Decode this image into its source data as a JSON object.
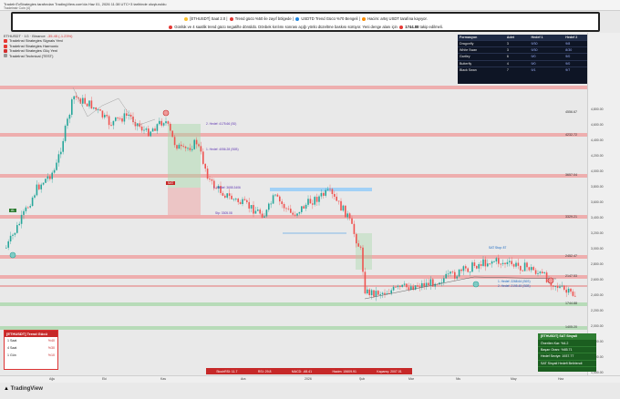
{
  "window": {
    "credit": "TradeInToStrategies tarafından TradingView.com'da Haz 01, 2026 11:38 UTC+3 tarihinde oluşturuldu",
    "symbol_label": "Tradeinstr Coin (4)"
  },
  "banner": {
    "line1_parts": [
      "[ETHUSDT] Saat 2.0",
      "Trend gücü %50 ile zayıf bölgede",
      "USDTD Trend Gücü %70 Bengeli",
      "Hacim: artış USDT tarafına kayıyor."
    ],
    "line2_parts": [
      "Günlük ve 4 saatlik trend gücü negatifte dönüldü. Dönbek kırılımı sonrası açığı yönlü düzeltme baskısı sürüyor. Yeni denge alanı için",
      "1744.88",
      "takip edilmeli."
    ]
  },
  "header": {
    "title": "ETHUSDT · 1G · Binance",
    "change": "-35.45 (-1.23%)",
    "indicators": [
      {
        "name": "TradeInst Strategies Signals Yeni",
        "color": "#e53935"
      },
      {
        "name": "TradeInst Strategies Harmonic",
        "color": "#e53935"
      },
      {
        "name": "TradeInst Strategies Güç Yeni",
        "color": "#d32f2f"
      },
      {
        "name": "TradeInst Technical (TEST)",
        "color": "#999999"
      }
    ]
  },
  "pattern_table": {
    "headers": [
      "Formasyon",
      "Adet",
      "Hedef 1",
      "Hedef 2"
    ],
    "rows": [
      [
        "Dragonfly",
        "3",
        "9/30",
        "9/8"
      ],
      [
        "White Swan",
        "3",
        "9/30",
        "8/30"
      ],
      [
        "Gartley",
        "6",
        "9/0",
        "9/0"
      ],
      [
        "Butterfly",
        "4",
        "9/0",
        "9/0"
      ],
      [
        "Black Swan",
        "7",
        "9/1",
        "9/7"
      ]
    ]
  },
  "levels": [
    {
      "label": "4556.67"
    },
    {
      "label": "4232.72"
    },
    {
      "label": "3657.04"
    },
    {
      "label": "3329.21"
    },
    {
      "label": "2452.47"
    },
    {
      "label": "2147.53"
    },
    {
      "label": "1744.88"
    },
    {
      "label": "1405.20"
    }
  ],
  "annotations": {
    "hedef2": "2. Hedef: 4175.66 (S0)",
    "hedef1": "1. Hedef: 4056.28 (S0B)",
    "mid": "1. Hedef: 3655.3406",
    "low": "Stp: 3305.08",
    "buy": "AL",
    "sell": "SAT",
    "break": "SAT Stop: 87",
    "bottom1": "1. Hedef: 2268.64 (S0S)",
    "bottom2": "2. Hedef: 2195.45 (S0B)"
  },
  "yaxis_ticks": [
    "4,800.00",
    "4,600.00",
    "4,400.00",
    "4,200.00",
    "4,000.00",
    "3,800.00",
    "3,600.00",
    "3,400.00",
    "3,200.00",
    "3,000.00",
    "2,800.00",
    "2,600.00",
    "2,400.00",
    "2,200.00",
    "2,000.00",
    "1,800.00",
    "1,600.00",
    "1,400.00"
  ],
  "xaxis_ticks": [
    "Ağu",
    "Eki",
    "Kas",
    "Ara",
    "2026",
    "Şub",
    "Mar",
    "Nis",
    "May",
    "Haz"
  ],
  "trend_table": {
    "title": "[ETHUSDT] Trend Gücü",
    "rows": [
      {
        "label": "1 Saat",
        "value": "%40"
      },
      {
        "label": "4 Saat",
        "value": "%30"
      },
      {
        "label": "1 Gün",
        "value": "%10"
      }
    ]
  },
  "signal_box": {
    "rows": [
      "[ETHUSDT] SAT Sinyali",
      "Önerilen Kar: %4.2",
      "Başarı Oranı: %85.71",
      "Hedef Seviye: 1937.77",
      "SAT Sinyali Hedefi Belirlendi"
    ]
  },
  "footer_bar": {
    "items": [
      "StochRSI: 11.7",
      "RSI: 29.8",
      "MACD: -68.41",
      "Hacim: 15609.91",
      "Kapanış: 2007.01"
    ]
  },
  "brand": {
    "name": "TradingView"
  },
  "colors": {
    "bull": "#26a69a",
    "bear": "#ef5350",
    "resistance": "#e57373",
    "support": "#81c784",
    "accent": "#c62828"
  }
}
